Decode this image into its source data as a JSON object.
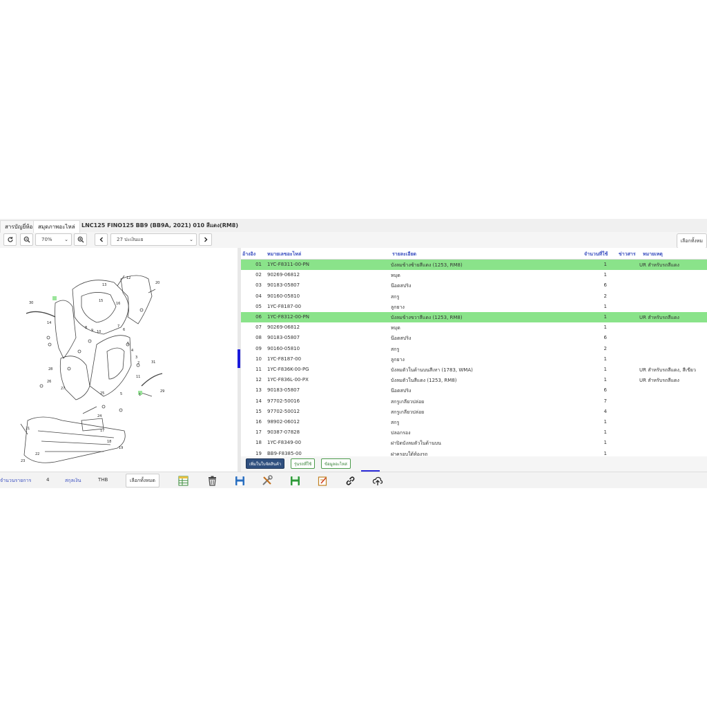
{
  "tabs": [
    {
      "label": "สารบัญยี่ห้อ"
    },
    {
      "label": "สมุดภาพอะไหล่"
    }
  ],
  "document_title": "LNC125 FINO125 BB9 (BB9A, 2021) 010 สีแดง(RM8)",
  "toolbar": {
    "zoom_value": "70%",
    "page_value": "27 ปะเงินแย",
    "select_all_label": "เลือกทั้งหม"
  },
  "table": {
    "headers": {
      "no": "อ้างอิง",
      "part_no": "หมายเลขอะไหล่",
      "desc": "รายละเอียด",
      "qty": "จำนวนที่ใช้",
      "news": "ข่าวสาร",
      "note": "หมายเหตุ"
    },
    "rows": [
      {
        "no": "01",
        "part_no": "1YC-F8311-00-PN",
        "desc": "บังลมข้างซ้ายสีแดง (1253, RM8)",
        "qty": "1",
        "note": "UR สำหรับรถสีแดง",
        "highlight": true
      },
      {
        "no": "02",
        "part_no": "90269-06812",
        "desc": "หมุด",
        "qty": "1",
        "note": "",
        "highlight": false
      },
      {
        "no": "03",
        "part_no": "90183-05807",
        "desc": "น๊อตสปริง",
        "qty": "6",
        "note": "",
        "highlight": false
      },
      {
        "no": "04",
        "part_no": "90160-05810",
        "desc": "สกรู",
        "qty": "2",
        "note": "",
        "highlight": false
      },
      {
        "no": "05",
        "part_no": "1YC-F8187-00",
        "desc": "ลูกยาง",
        "qty": "1",
        "note": "",
        "highlight": false
      },
      {
        "no": "06",
        "part_no": "1YC-F8312-00-PN",
        "desc": "บังลมข้างขวาสีแดง (1253, RM8)",
        "qty": "1",
        "note": "UR สำหรับรถสีแดง",
        "highlight": true
      },
      {
        "no": "07",
        "part_no": "90269-06812",
        "desc": "หมุด",
        "qty": "1",
        "note": "",
        "highlight": false
      },
      {
        "no": "08",
        "part_no": "90183-05807",
        "desc": "น๊อตสปริง",
        "qty": "6",
        "note": "",
        "highlight": false
      },
      {
        "no": "09",
        "part_no": "90160-05810",
        "desc": "สกรู",
        "qty": "2",
        "note": "",
        "highlight": false
      },
      {
        "no": "10",
        "part_no": "1YC-F8187-00",
        "desc": "ลูกยาง",
        "qty": "1",
        "note": "",
        "highlight": false
      },
      {
        "no": "11",
        "part_no": "1YC-F836K-00-PG",
        "desc": "บังลมตัวในด้านบนสีเทา (1783, WMA)",
        "qty": "1",
        "note": "UR สำหรับรถสีแดง, สีเขียว",
        "highlight": false
      },
      {
        "no": "12",
        "part_no": "1YC-F836L-00-PX",
        "desc": "บังลมตัวในสีแดง (1253, RM8)",
        "qty": "1",
        "note": "UR สำหรับรถสีแดง",
        "highlight": false
      },
      {
        "no": "13",
        "part_no": "90183-05807",
        "desc": "น๊อตสปริง",
        "qty": "6",
        "note": "",
        "highlight": false
      },
      {
        "no": "14",
        "part_no": "97702-50016",
        "desc": "สกรูเกลียวปล่อย",
        "qty": "7",
        "note": "",
        "highlight": false
      },
      {
        "no": "15",
        "part_no": "97702-50012",
        "desc": "สกรูเกลียวปล่อย",
        "qty": "4",
        "note": "",
        "highlight": false
      },
      {
        "no": "16",
        "part_no": "98902-06012",
        "desc": "สกรู",
        "qty": "1",
        "note": "",
        "highlight": false
      },
      {
        "no": "17",
        "part_no": "90387-07828",
        "desc": "ปลอกรอง",
        "qty": "1",
        "note": "",
        "highlight": false
      },
      {
        "no": "18",
        "part_no": "1YC-F8349-00",
        "desc": "ฝาปิดบังลมตัวในด้านบน",
        "qty": "1",
        "note": "",
        "highlight": false
      },
      {
        "no": "19",
        "part_no": "BB9-F8385-00",
        "desc": "ฝาครอบใต้ท้องรถ",
        "qty": "1",
        "note": "",
        "highlight": false
      }
    ]
  },
  "actions": {
    "add_to_list": "เพิ่มในใบจัดสินค้า",
    "models": "รุ่นรถที่ใช้",
    "part_info": "ข้อมูลอะไหล่"
  },
  "status": {
    "items_label": "จำนวนรายการ",
    "items_count": "4",
    "currency_label": "สกุลเงิน",
    "currency": "THB",
    "select_all": "เลือกทั้งหมด"
  },
  "diagram_callouts": [
    "12",
    "13",
    "20",
    "15",
    "16",
    "30",
    "8",
    "9",
    "10",
    "14",
    "7",
    "6",
    "5",
    "4",
    "3",
    "2",
    "1",
    "11",
    "28",
    "27",
    "26",
    "25",
    "24",
    "23",
    "22",
    "21",
    "17",
    "18",
    "19",
    "31",
    "29"
  ],
  "colors": {
    "highlight_row": "#8ae38a",
    "header_text": "#3a4fc0",
    "primary_button": "#2f4f7f",
    "accent_blue": "#1a1adb"
  }
}
